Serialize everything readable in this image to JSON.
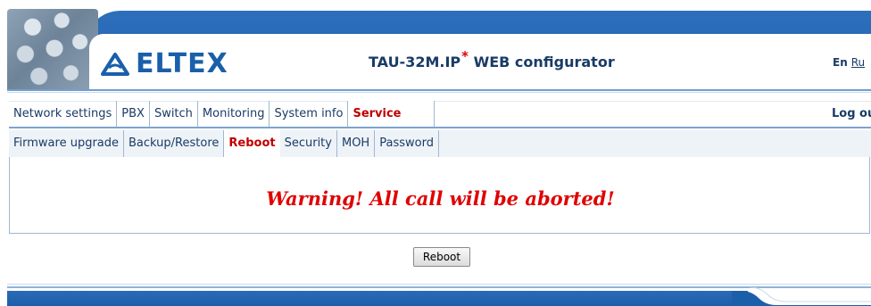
{
  "header": {
    "logo_text": "ELTEX",
    "title": "TAU-32M.IP",
    "title_star": "*",
    "title_suffix": "WEB configurator",
    "lang_current": "En",
    "lang_other": "Ru"
  },
  "menu": {
    "items": [
      {
        "label": "Network settings"
      },
      {
        "label": "PBX"
      },
      {
        "label": "Switch"
      },
      {
        "label": "Monitoring"
      },
      {
        "label": "System info"
      },
      {
        "label": "Service"
      }
    ],
    "active": "Service",
    "logout_label": "Log out"
  },
  "submenu": {
    "items": [
      {
        "label": "Firmware upgrade"
      },
      {
        "label": "Backup/Restore"
      },
      {
        "label": "Reboot"
      },
      {
        "label": "Security"
      },
      {
        "label": "MOH"
      },
      {
        "label": "Password"
      }
    ],
    "active": "Reboot"
  },
  "content": {
    "warning": "Warning! All call will be aborted!",
    "reboot_button": "Reboot"
  },
  "colors": {
    "brand_blue": "#1a5faa",
    "warning_red": "#e00000",
    "active_tab_red": "#c00000"
  }
}
